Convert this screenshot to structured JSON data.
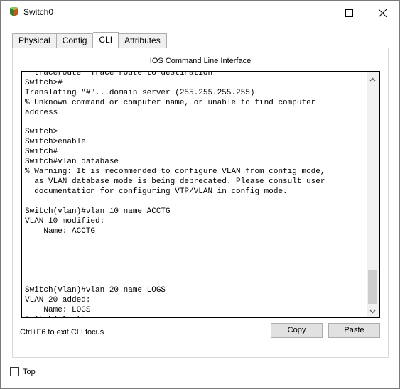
{
  "window": {
    "title": "Switch0",
    "icon": "cisco-switch-icon"
  },
  "title_controls": {
    "minimize": "minimize-icon",
    "maximize": "maximize-icon",
    "close": "close-icon"
  },
  "tabs": [
    {
      "label": "Physical",
      "active": false
    },
    {
      "label": "Config",
      "active": false
    },
    {
      "label": "CLI",
      "active": true
    },
    {
      "label": "Attributes",
      "active": false
    }
  ],
  "cli": {
    "heading": "IOS Command Line Interface",
    "output": "  traceroute  Trace route to destination\nSwitch>#\nTranslating \"#\"...domain server (255.255.255.255)\n% Unknown command or computer name, or unable to find computer\naddress\n\nSwitch>\nSwitch>enable\nSwitch#\nSwitch#vlan database\n% Warning: It is recommended to configure VLAN from config mode,\n  as VLAN database mode is being deprecated. Please consult user\n  documentation for configuring VTP/VLAN in config mode.\n\nSwitch(vlan)#vlan 10 name ACCTG\nVLAN 10 modified:\n    Name: ACCTG\n\n\n\n\n\nSwitch(vlan)#vlan 20 name LOGS\nVLAN 20 added:\n    Name: LOGS\nSwitch(vlan)#",
    "exit_hint": "Ctrl+F6 to exit CLI focus",
    "copy_label": "Copy",
    "paste_label": "Paste",
    "scroll_position": 0.95
  },
  "footer": {
    "top_label": "Top",
    "top_checked": false
  }
}
